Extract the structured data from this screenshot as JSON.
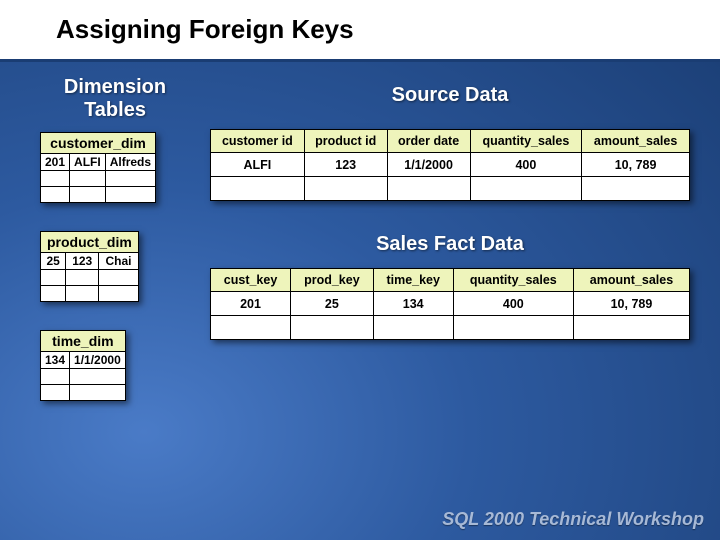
{
  "title": "Assigning Foreign Keys",
  "headings": {
    "dimension_tables": "Dimension Tables",
    "source_data": "Source Data",
    "sales_fact_data": "Sales Fact Data"
  },
  "dim_tables": {
    "customer": {
      "name": "customer_dim",
      "row": {
        "key": "201",
        "id": "ALFI",
        "name": "Alfreds"
      }
    },
    "product": {
      "name": "product_dim",
      "row": {
        "key": "25",
        "id": "123",
        "name": "Chai"
      }
    },
    "time": {
      "name": "time_dim",
      "row": {
        "key": "134",
        "date": "1/1/2000"
      }
    }
  },
  "source_data_table": {
    "headers": [
      "customer id",
      "product id",
      "order date",
      "quantity_sales",
      "amount_sales"
    ],
    "row": [
      "ALFI",
      "123",
      "1/1/2000",
      "400",
      "10, 789"
    ]
  },
  "fact_table": {
    "headers": [
      "cust_key",
      "prod_key",
      "time_key",
      "quantity_sales",
      "amount_sales"
    ],
    "row": [
      "201",
      "25",
      "134",
      "400",
      "10, 789"
    ]
  },
  "footer_brand": "SQL 2000 Technical Workshop"
}
